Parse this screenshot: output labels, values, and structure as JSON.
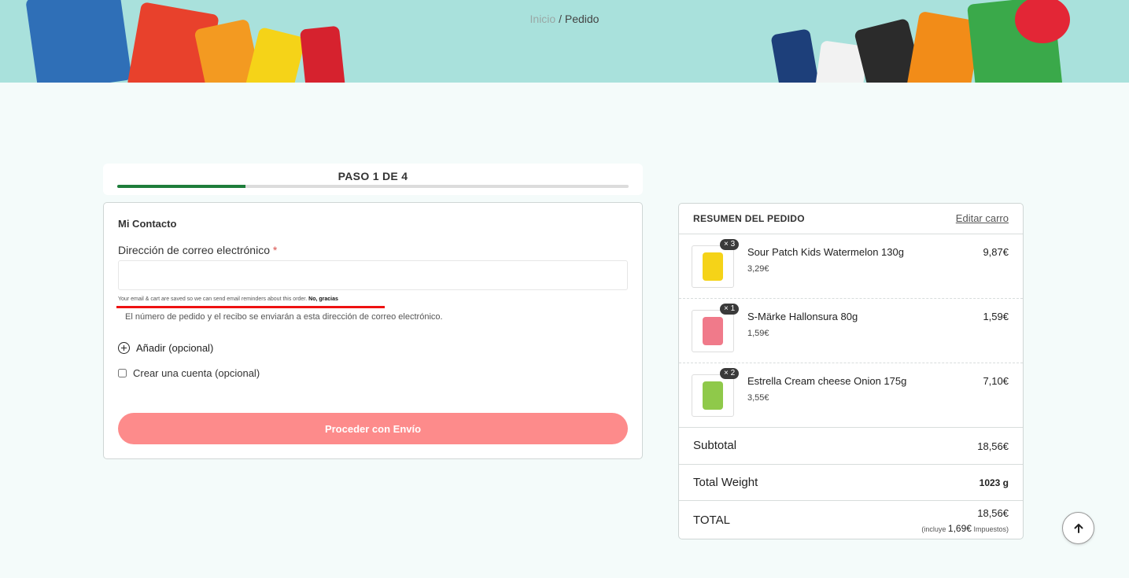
{
  "breadcrumb": {
    "home": "Inicio",
    "separator": "/",
    "current": "Pedido"
  },
  "steps": {
    "label": "PASO 1 DE 4",
    "current": 1,
    "total": 4
  },
  "contact": {
    "section_title": "Mi Contacto",
    "email_label": "Dirección de correo electrónico",
    "required_mark": "*",
    "email_value": "",
    "saved_note": "Your email & cart are saved so we can send email reminders about this order.",
    "no_thanks": "No, gracias",
    "receipt_note": "El número de pedido y el recibo se enviarán a esta dirección de correo electrónico.",
    "add_optional": "Añadir (opcional)",
    "create_account": "Crear una cuenta (opcional)",
    "proceed_button": "Proceder con Envío"
  },
  "summary": {
    "title": "RESUMEN DEL PEDIDO",
    "edit_cart": "Editar carro",
    "items": [
      {
        "qty": "× 3",
        "name": "Sour Patch Kids Watermelon 130g",
        "unit_price": "3,29€",
        "total": "9,87€",
        "color": "#f5d318"
      },
      {
        "qty": "× 1",
        "name": "S-Märke Hallonsura 80g",
        "unit_price": "1,59€",
        "total": "1,59€",
        "color": "#f07a8a"
      },
      {
        "qty": "× 2",
        "name": "Estrella Cream cheese Onion 175g",
        "unit_price": "3,55€",
        "total": "7,10€",
        "color": "#8fc94a"
      }
    ],
    "subtotal_label": "Subtotal",
    "subtotal_value": "18,56€",
    "weight_label": "Total Weight",
    "weight_value": "1023 g",
    "total_label": "TOTAL",
    "total_value": "18,56€",
    "tax_prefix": "(incluye",
    "tax_value": "1,69€",
    "tax_suffix": "Impuestos)"
  },
  "colors": {
    "accent_green": "#1e7d3b",
    "button_pink": "#fd8b8b",
    "banner": "#a9e1dc"
  },
  "icons": {
    "add": "plus-circle-icon",
    "scroll_top": "arrow-up-icon"
  }
}
